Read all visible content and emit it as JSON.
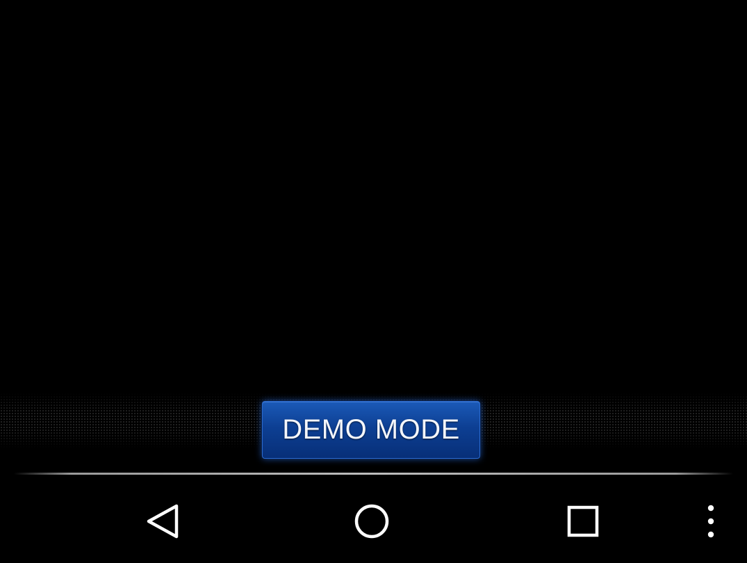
{
  "main": {
    "mode_button_label": "DEMO MODE"
  },
  "navigation": {
    "icons": [
      "back-icon",
      "home-icon",
      "recents-icon",
      "overflow-menu-icon"
    ]
  },
  "colors": {
    "background": "#000000",
    "button_blue": "#0d3f93",
    "button_glow": "#286ee6",
    "text": "#f4f6fb",
    "nav_icon": "#ffffff"
  }
}
